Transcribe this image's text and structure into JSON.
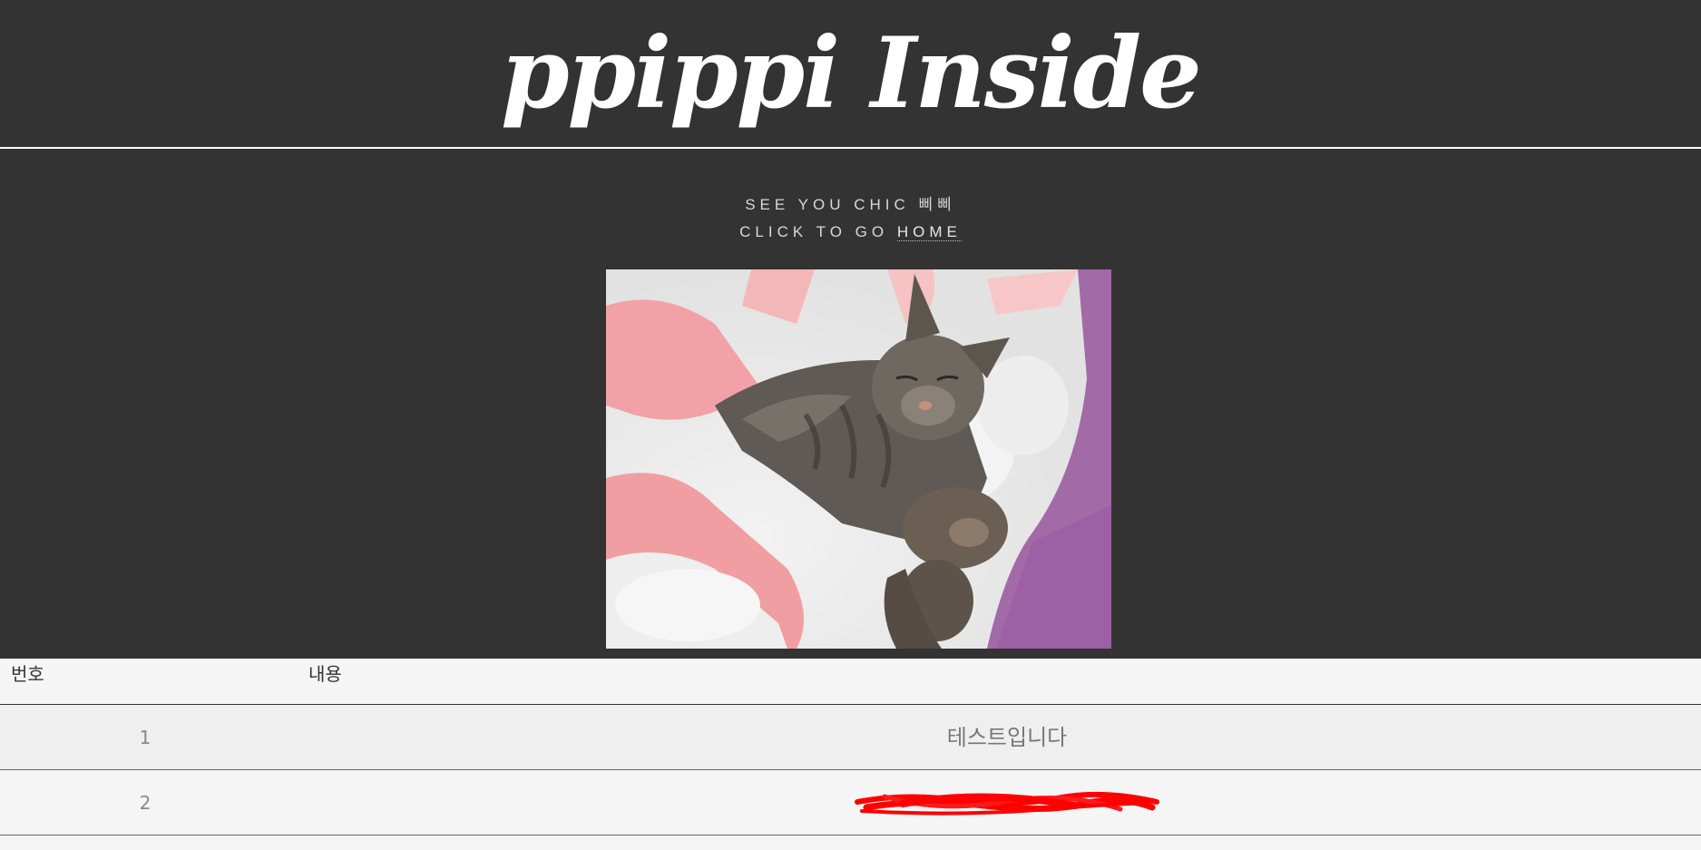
{
  "header": {
    "title": "ppippi Inside"
  },
  "intro": {
    "line1": "SEE YOU CHIC 삐삐",
    "line2_prefix": "CLICK TO GO ",
    "home_link": "HOME"
  },
  "table": {
    "headers": [
      "번호",
      "내용"
    ],
    "rows": [
      {
        "num": "1",
        "content": "테스트입니다",
        "redacted": false
      },
      {
        "num": "2",
        "content": "",
        "redacted": true
      }
    ]
  },
  "colors": {
    "background": "#333333",
    "table_background": "#f5f5f5",
    "redaction": "#ff0000"
  }
}
